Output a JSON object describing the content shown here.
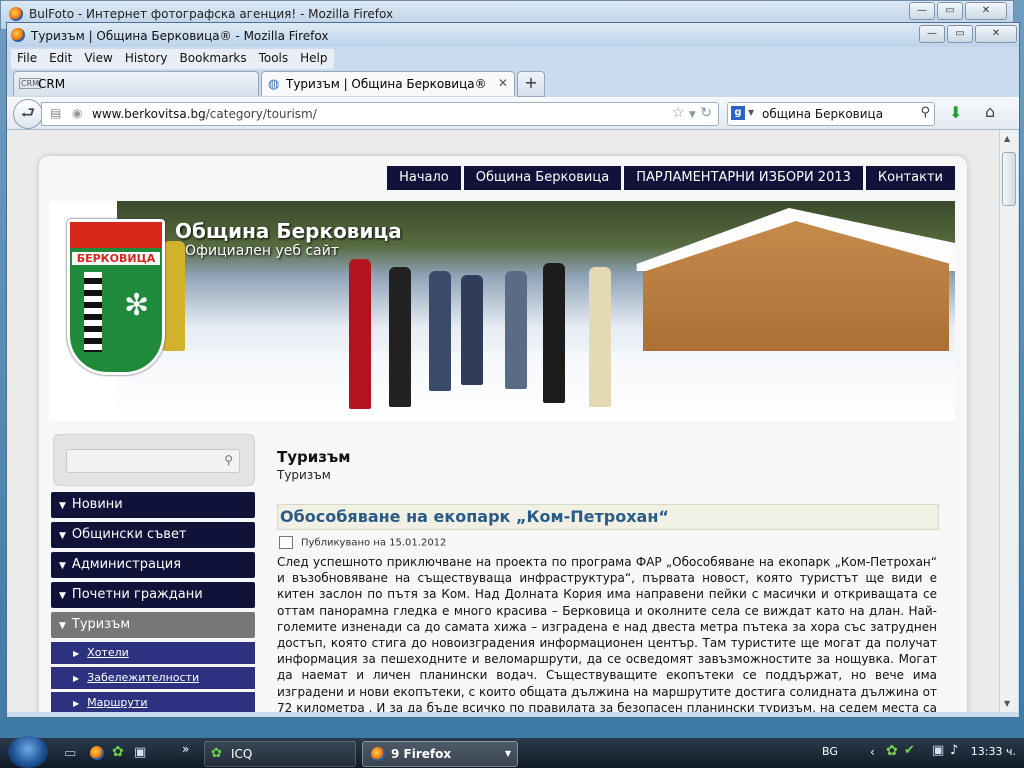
{
  "bg_window": {
    "title": "BulFoto - Интернет фотографска агенция! - Mozilla Firefox"
  },
  "window": {
    "title": "Туризъм | Община Берковица® - Mozilla Firefox"
  },
  "menubar": [
    "File",
    "Edit",
    "View",
    "History",
    "Bookmarks",
    "Tools",
    "Help"
  ],
  "tabs": [
    {
      "label": "CRM"
    },
    {
      "label": "Туризъм | Община Берковица®"
    }
  ],
  "newtab": "+",
  "address": {
    "domain": "www.berkovitsa.bg",
    "path": "/category/tourism/"
  },
  "search": {
    "engine": "g",
    "value": "община Берковица"
  },
  "site": {
    "topnav": [
      "Начало",
      "Община Берковица",
      "ПАРЛАМЕНТАРНИ ИЗБОРИ 2013",
      "Контакти"
    ],
    "banner_title": "Община Берковица",
    "banner_subtitle": "Официален уеб сайт",
    "crest_name": "БЕРКОВИЦА",
    "sidebar_menu": [
      "Новини",
      "Общински съвет",
      "Администрация",
      "Почетни граждани",
      "Туризъм"
    ],
    "submenu": [
      "Хотели",
      "Забележителности",
      "Маршрути"
    ]
  },
  "content": {
    "heading": "Туризъм",
    "breadcrumb": "Туризъм",
    "post_title": "Обособяване на екопарк „Ком-Петрохан“",
    "published": "Публикувано на 15.01.2012",
    "body": "След успешното приключване на проекта по програма ФАР „Обособяване на екопарк „Ком-Петрохан“ и възобновяване на съществуваща инфраструктура“, първата новост, която туристът ще види е китен заслон по пътя за Ком. Над Долната Кория има направени пейки с масички и откриващата се оттам панорамна гледка е много красива – Берковица и околните села се виждат като на длан. Най-големите изненади са до самата хижа – изградена е над двеста метра пътека за хора със затруднен достъп, която стига до новоизградения информационен център. Там туристите ще могат да получат информация за пешеходните и веломаршрути, да се осведомят завъзможностите за нощувка. Могат да наемат и личен планински водач. Съществуващите екопътеки се поддържат, но вече има изградени и нови екопътеки, с които общата дължина на маршрутите достига солидната дължина от 72 километра . И за да бъде всичко по правилата за безопасен планински туризъм, на седем места са поставени информационни табла, отделно има и"
  },
  "taskbar": {
    "icq": "ICQ",
    "firefox": "9 Firefox",
    "lang": "BG",
    "clock": "13:33 ч."
  }
}
